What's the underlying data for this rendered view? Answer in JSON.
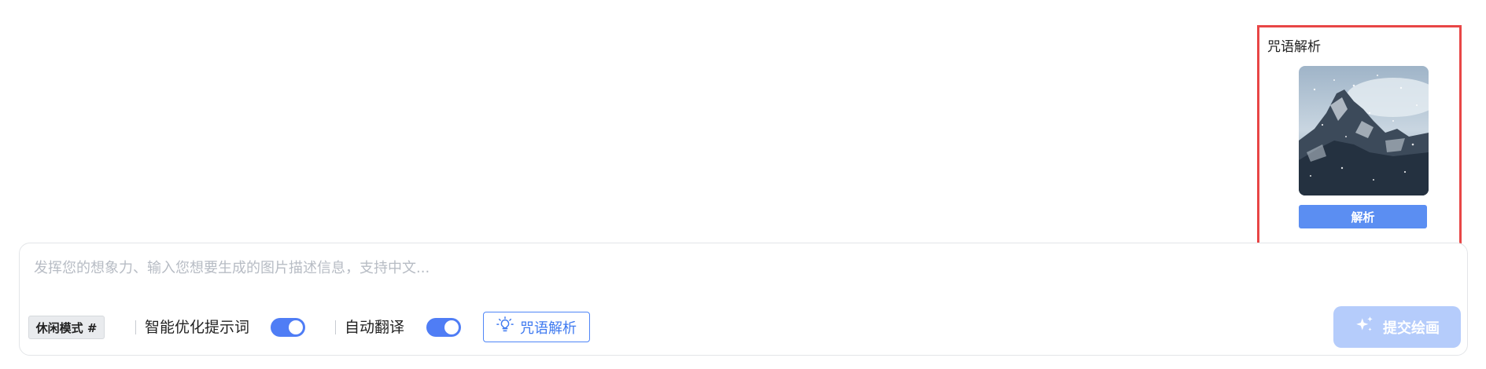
{
  "popover": {
    "title": "咒语解析",
    "analyze_label": "解析"
  },
  "prompt": {
    "placeholder": "发挥您的想象力、输入您想要生成的图片描述信息，支持中文..."
  },
  "toolbar": {
    "mode_label": "休闲模式 #",
    "smart_optimize_label": "智能优化提示词",
    "smart_optimize_on": true,
    "auto_translate_label": "自动翻译",
    "auto_translate_on": true,
    "spell_analysis_label": "咒语解析"
  },
  "submit": {
    "label": "提交绘画"
  },
  "colors": {
    "accent": "#4f7df5",
    "submit_disabled": "#b5ccfb",
    "highlight_border": "#e84646"
  }
}
